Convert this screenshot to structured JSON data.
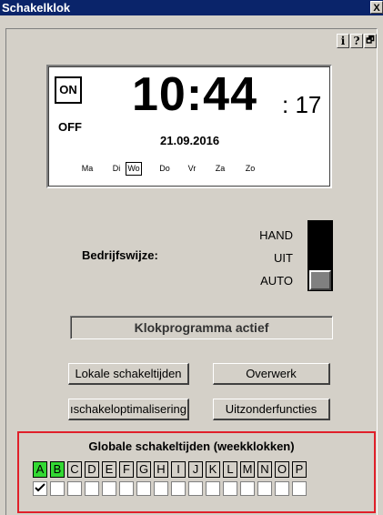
{
  "window": {
    "title": "Schakelklok",
    "close_glyph": "X"
  },
  "toolbar": {
    "info": "i",
    "help": "?",
    "window": "🗗"
  },
  "clock": {
    "on_label": "ON",
    "off_label": "OFF",
    "time_main": "10:44",
    "time_seconds": ": 17",
    "date": "21.09.2016",
    "days": [
      "Ma",
      "Di",
      "Wo",
      "Do",
      "Vr",
      "Za",
      "Zo"
    ],
    "selected_day": "Wo"
  },
  "mode": {
    "label": "Bedrijfswijze:",
    "options": [
      "HAND",
      "UIT",
      "AUTO"
    ],
    "selected": "AUTO"
  },
  "status": {
    "text": "Klokprogramma actief"
  },
  "buttons": {
    "lokale": "Lokale schakeltijden",
    "overwerk": "Overwerk",
    "optimalisering": "ıschakeloptimalisering",
    "uitzonder": "Uitzonderfuncties"
  },
  "global": {
    "title": "Globale schakeltijden (weekklokken)",
    "letters": [
      "A",
      "B",
      "C",
      "D",
      "E",
      "F",
      "G",
      "H",
      "I",
      "J",
      "K",
      "L",
      "M",
      "N",
      "O",
      "P"
    ],
    "active": [
      "A",
      "B"
    ],
    "checked": [
      "A"
    ],
    "active_color": "#33d933"
  },
  "colors": {
    "titlebar": "#0a246a",
    "highlight": "#e0202a",
    "face": "#d4d0c8"
  }
}
